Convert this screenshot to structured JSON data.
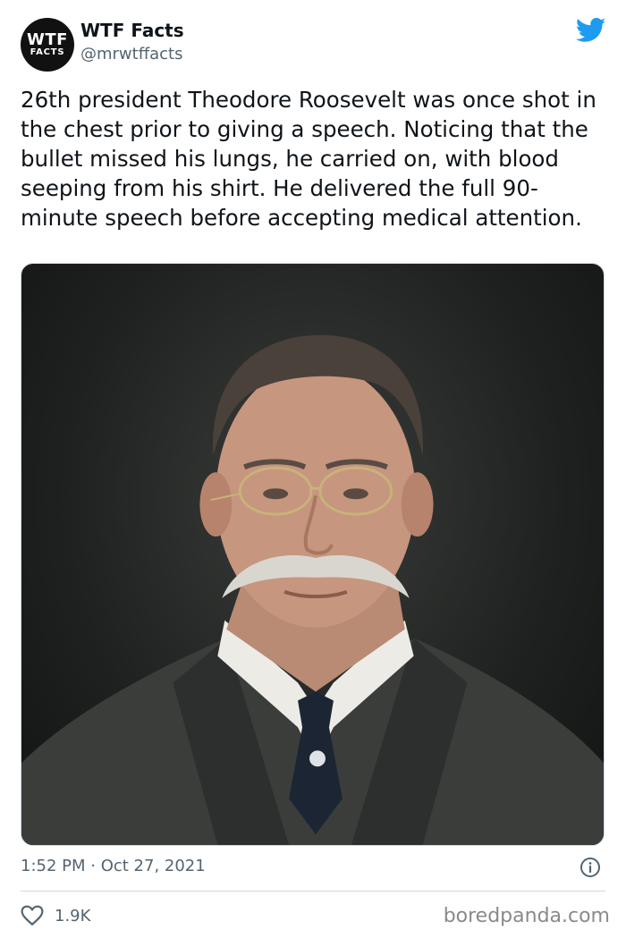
{
  "account": {
    "avatar_line1": "WTF",
    "avatar_line2": "FACTS",
    "display_name": "WTF Facts",
    "handle": "@mrwtffacts"
  },
  "tweet": {
    "text": "26th president Theodore Roosevelt was once shot in the chest prior to giving a speech. Noticing that the bullet missed his lungs, he carried on, with blood seeping from his shirt. He delivered the full 90-minute speech before accepting medical attention.",
    "timestamp": "1:52 PM · Oct 27, 2021",
    "likes": "1.9K"
  },
  "watermark": "boredpanda.com",
  "icons": {
    "platform": "twitter-bird-icon",
    "info": "info-icon",
    "like": "heart-icon"
  },
  "colors": {
    "brand_blue": "#1d9bf0",
    "text": "#0f1419",
    "muted": "#536471"
  }
}
